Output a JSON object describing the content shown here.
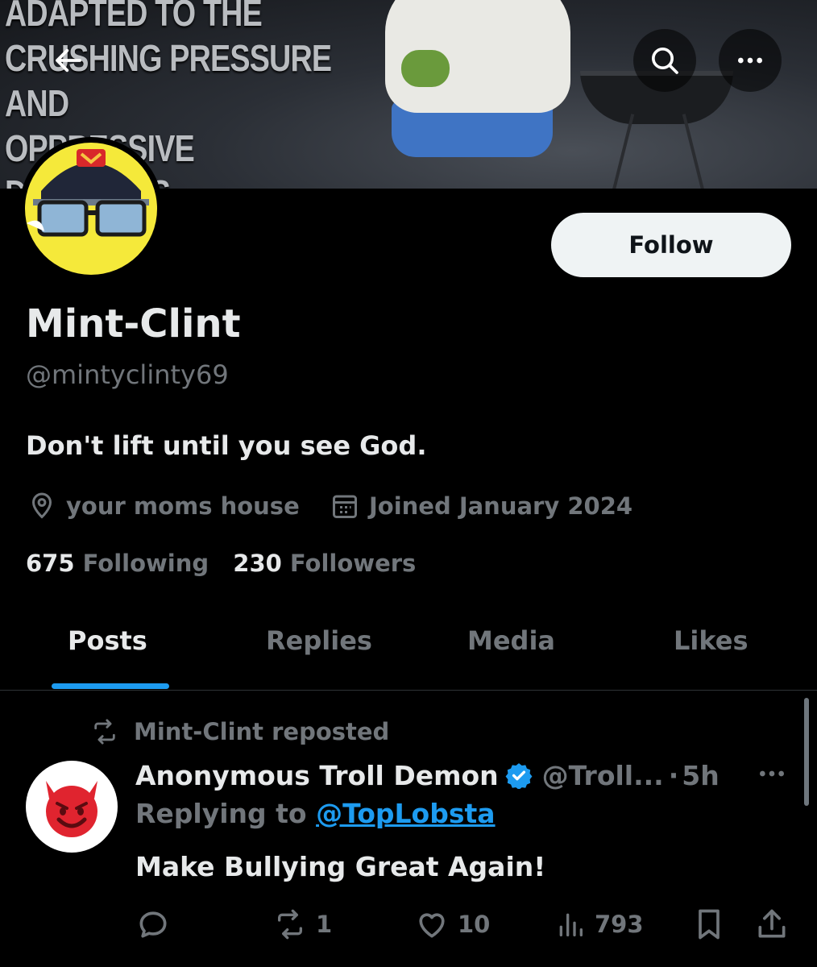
{
  "banner": {
    "text": "ADAPTED TO THE\nCRUSHING PRESSURE AND\nOPPRESSIVE DARKNESS"
  },
  "header": {
    "back_icon": "arrow-left-icon",
    "search_icon": "search-icon",
    "more_icon": "more-horizontal-icon"
  },
  "profile": {
    "avatar_icon": "duck-pilot-avatar",
    "follow_label": "Follow",
    "display_name": "Mint-Clint",
    "handle": "@mintyclinty69",
    "bio": "Don't lift until you see God.",
    "location": "your moms house",
    "joined": "Joined January 2024",
    "following_count": "675",
    "following_label": "Following",
    "followers_count": "230",
    "followers_label": "Followers"
  },
  "tabs": [
    {
      "label": "Posts",
      "active": true
    },
    {
      "label": "Replies",
      "active": false
    },
    {
      "label": "Media",
      "active": false
    },
    {
      "label": "Likes",
      "active": false
    }
  ],
  "post": {
    "repost_label": "Mint-Clint reposted",
    "avatar_icon": "smiling-devil-icon",
    "author": "Anonymous Troll Demon",
    "verified_icon": "verified-badge-icon",
    "handle": "@Troll...",
    "separator": "·",
    "time": "5h",
    "replying_prefix": "Replying to",
    "replying_to": "@TopLobsta",
    "text": "Make Bullying Great Again!",
    "replies": "",
    "reposts": "1",
    "likes": "10",
    "views": "793"
  },
  "colors": {
    "background": "#000000",
    "text_primary": "#e7e9ea",
    "text_secondary": "#71767b",
    "accent": "#1d9bf0",
    "follow_button": "#eff3f4"
  }
}
